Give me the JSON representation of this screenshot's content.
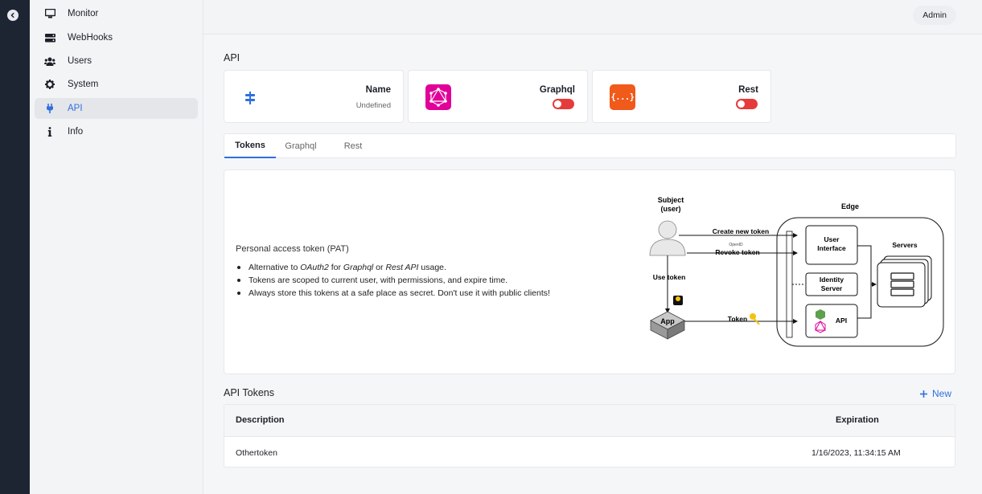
{
  "sidebar": {
    "items": [
      {
        "label": "Monitor",
        "icon": "monitor-icon"
      },
      {
        "label": "WebHooks",
        "icon": "server-icon"
      },
      {
        "label": "Users",
        "icon": "users-icon"
      },
      {
        "label": "System",
        "icon": "gear-icon"
      },
      {
        "label": "API",
        "icon": "plug-icon",
        "active": true
      },
      {
        "label": "Info",
        "icon": "info-icon"
      }
    ]
  },
  "topbar": {
    "user_label": "Admin"
  },
  "page": {
    "title": "API"
  },
  "cards": {
    "name": {
      "title": "Name",
      "value": "Undefined"
    },
    "graphql": {
      "title": "Graphql",
      "enabled": false
    },
    "rest": {
      "title": "Rest",
      "logo_text": "{...}",
      "enabled": false
    }
  },
  "tabs": [
    "Tokens",
    "Graphql",
    "Rest"
  ],
  "pat": {
    "title": "Personal access token (PAT)",
    "bullets": [
      {
        "parts": [
          "Alternative to ",
          "OAuth2",
          " for ",
          "Graphql",
          " or ",
          "Rest API",
          " usage."
        ]
      },
      {
        "text": "Tokens are scoped to current user, with permissions, and expire time."
      },
      {
        "text": "Always store this tokens at a safe place as secret. Don't use it with public clients!"
      }
    ]
  },
  "diagram": {
    "subject_line1": "Subject",
    "subject_line2": "(user)",
    "edge_label": "Edge",
    "create_token": "Create new token",
    "openid": "OpenID",
    "revoke_token": "Revoke token",
    "use_token": "Use token",
    "app": "App",
    "token": "Token",
    "ui_line1": "User",
    "ui_line2": "Interface",
    "identity_line1": "Identity",
    "identity_line2": "Server",
    "api": "API",
    "servers": "Servers"
  },
  "tokens_section": {
    "title": "API Tokens",
    "new_label": "New"
  },
  "table": {
    "columns": [
      "Description",
      "Expiration"
    ],
    "rows": [
      {
        "description": "Othertoken",
        "expiration": "1/16/2023, 11:34:15 AM"
      }
    ]
  },
  "colors": {
    "accent": "#2f6fdf",
    "graphql": "#e10098",
    "rest": "#f05a1a",
    "toggle_off": "#e53b3b",
    "rail": "#1e2532"
  }
}
